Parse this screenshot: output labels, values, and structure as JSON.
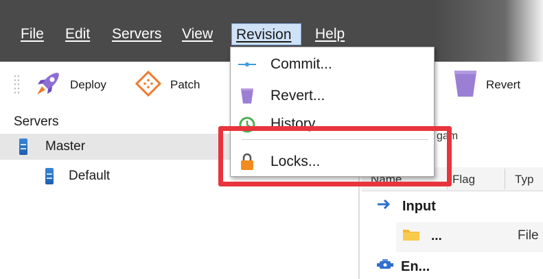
{
  "menubar": {
    "items": [
      {
        "label": "File"
      },
      {
        "label": "Edit"
      },
      {
        "label": "Servers"
      },
      {
        "label": "View"
      },
      {
        "label": "Revision"
      },
      {
        "label": "Help"
      }
    ]
  },
  "toolbar": {
    "deploy_label": "Deploy",
    "patch_label": "Patch",
    "revert_label": "Revert"
  },
  "servers_panel": {
    "title": "Servers",
    "tree": [
      {
        "label": "Master",
        "selected": true
      },
      {
        "label": "Default"
      }
    ]
  },
  "right_panel": {
    "partial_label": "gam",
    "columns": [
      "Name",
      "Flag",
      "Typ"
    ],
    "rows": [
      {
        "label": "Input"
      },
      {
        "label": "...",
        "type": "File"
      },
      {
        "label": "En..."
      }
    ]
  },
  "revision_menu": {
    "items": [
      {
        "label": "Commit..."
      },
      {
        "label": "Revert..."
      },
      {
        "label": "History"
      },
      {
        "label": "Locks..."
      }
    ]
  },
  "colors": {
    "menubar_bg": "#4a4a4a",
    "highlight": "#e8343c",
    "revert_icon": "#9b7fd4",
    "lock_icon": "#f28c1e"
  },
  "icons": [
    "grip-icon",
    "rocket-icon",
    "patch-icon",
    "revert-icon",
    "server-icon",
    "commit-icon",
    "history-icon",
    "lock-icon",
    "input-arrow-icon",
    "folder-icon",
    "engine-icon"
  ]
}
